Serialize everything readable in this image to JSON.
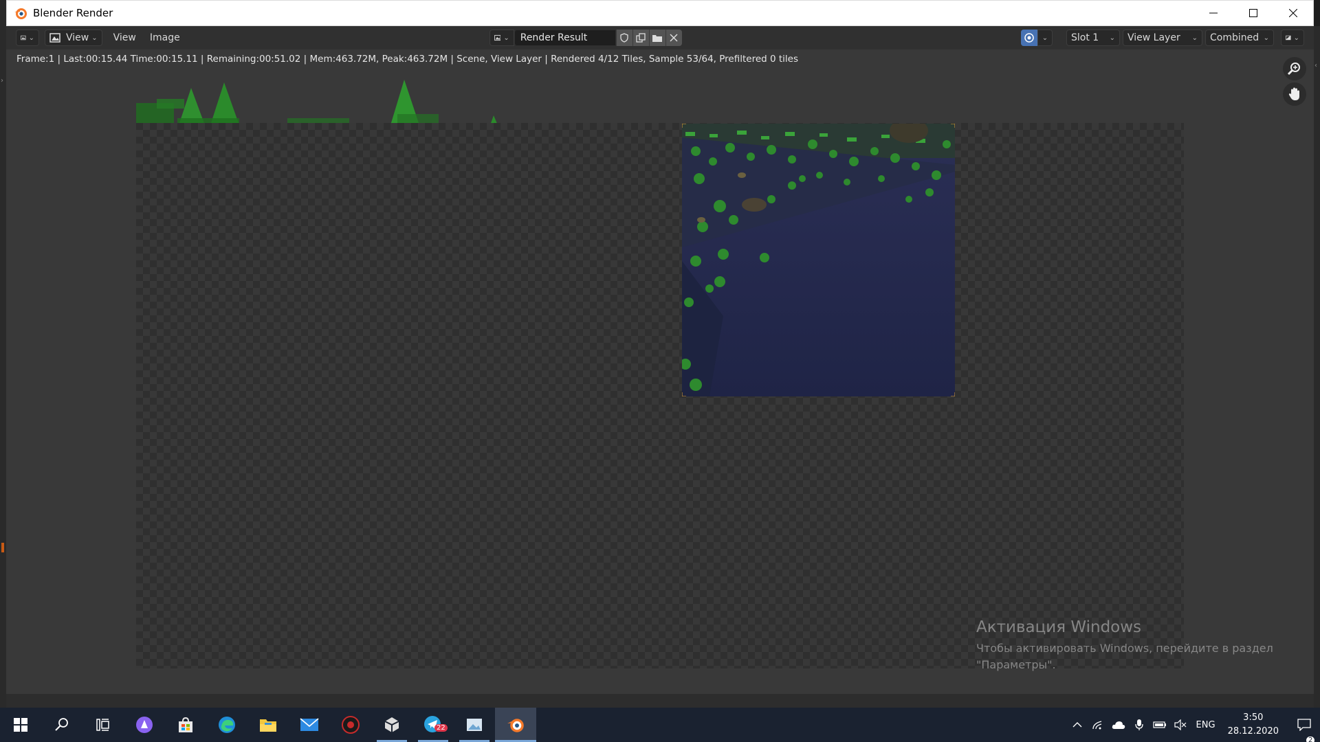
{
  "window": {
    "title": "Blender Render"
  },
  "header": {
    "view_menu": "View",
    "view_menu2": "View",
    "image_menu": "Image",
    "image_name": "Render Result",
    "slot": "Slot 1",
    "view_layer": "View Layer",
    "pass": "Combined"
  },
  "status": {
    "text": "Frame:1 | Last:00:15.44 Time:00:15.11 | Remaining:00:51.02 | Mem:463.72M, Peak:463.72M | Scene, View Layer | Rendered 4/12 Tiles, Sample 53/64, Prefiltered 0 tiles"
  },
  "render": {
    "tiles_done": 4,
    "tiles_total": 12,
    "sample": 53,
    "sample_total": 64
  },
  "watermark": {
    "title": "Активация Windows",
    "line1": "Чтобы активировать Windows, перейдите в раздел",
    "line2": "\"Параметры\"."
  },
  "taskbar": {
    "telegram_badge": "22",
    "language": "ENG",
    "time": "3:50",
    "date": "28.12.2020",
    "notification_count": "2"
  },
  "colors": {
    "blender_orange": "#f5792a",
    "accent_blue": "#4772b3"
  }
}
